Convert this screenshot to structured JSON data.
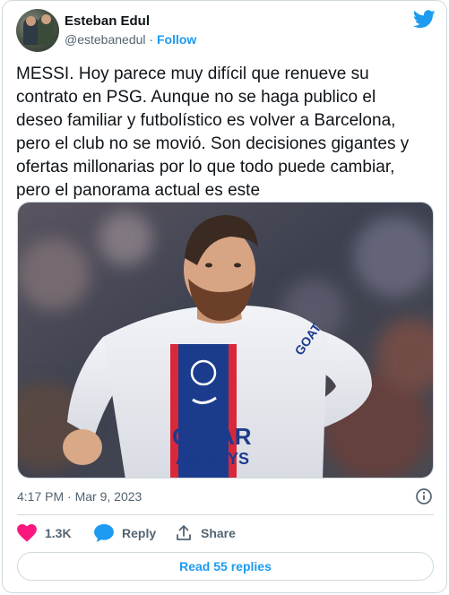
{
  "author": {
    "name": "Esteban Edul",
    "handle": "@estebanedul",
    "separator": "·",
    "follow_label": "Follow"
  },
  "brand": {
    "icon": "twitter-bird-icon",
    "color": "#1d9bf0"
  },
  "tweet": {
    "lines": [
      "MESSI. Hoy parece muy difícil que renueve su",
      "contrato en PSG. Aunque no se haga publico el",
      "deseo familiar y futbolístico es volver a Barcelona,",
      "pero el club no se movió. Son decisiones gigantes y",
      "ofertas millonarias por lo que todo puede cambiar,",
      "pero el panorama actual es este"
    ],
    "jersey_text": {
      "line1": "QATAR",
      "line2": "AIRWAYS",
      "sleeve": "GOAT"
    }
  },
  "meta": {
    "time": "4:17 PM",
    "separator": "·",
    "date": "Mar 9, 2023",
    "info_icon": "info-icon"
  },
  "actions": {
    "likes": {
      "icon": "heart-icon",
      "count": "1.3K",
      "color": "#f91880"
    },
    "reply": {
      "icon": "reply-bubble-icon",
      "label": "Reply",
      "color": "#1d9bf0"
    },
    "share": {
      "icon": "share-icon",
      "label": "Share"
    }
  },
  "read_replies_label": "Read 55 replies"
}
